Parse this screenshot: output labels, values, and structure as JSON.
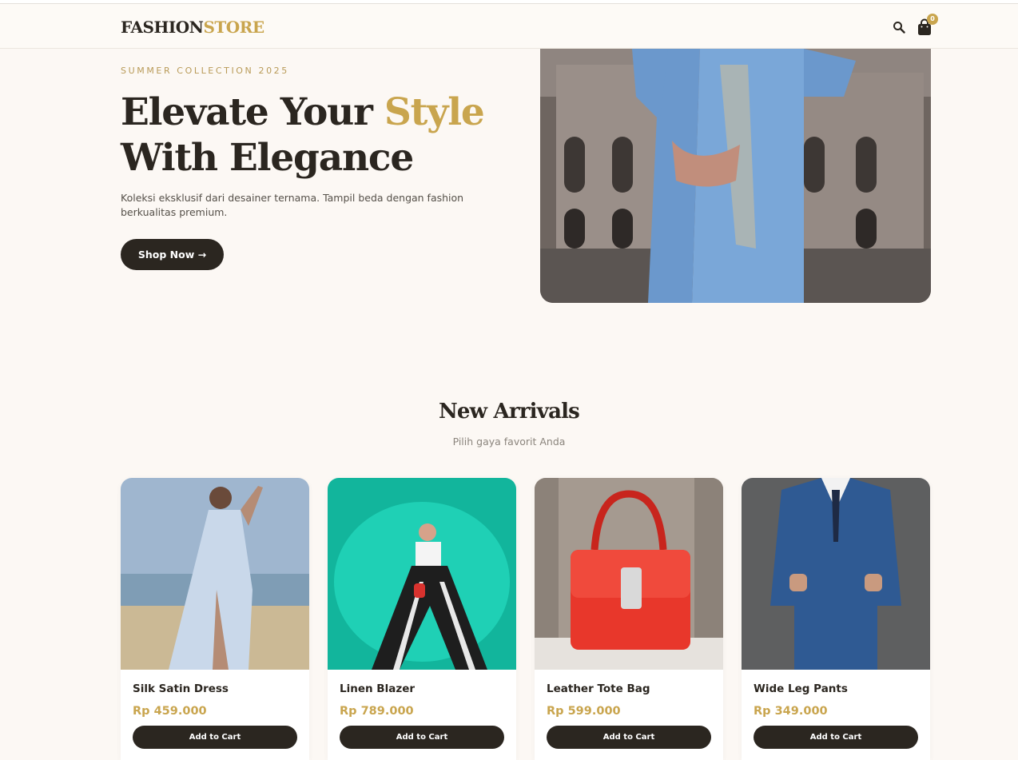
{
  "brand": {
    "name_dark": "FASHION",
    "name_accent": "STORE"
  },
  "header": {
    "cart_count": "0"
  },
  "hero": {
    "eyebrow": "SUMMER COLLECTION 2025",
    "title_line1_dark": "Elevate Your ",
    "title_line1_accent": "Style",
    "title_line2": "With Elegance",
    "description": "Koleksi eksklusif dari desainer ternama. Tampil beda dengan fashion berkualitas premium.",
    "cta_label": "Shop Now →"
  },
  "arrivals": {
    "title": "New Arrivals",
    "subtitle": "Pilih gaya favorit Anda",
    "products": [
      {
        "name": "Silk Satin Dress",
        "price": "Rp 459.000",
        "button": "Add to Cart"
      },
      {
        "name": "Linen Blazer",
        "price": "Rp 789.000",
        "button": "Add to Cart"
      },
      {
        "name": "Leather Tote Bag",
        "price": "Rp 599.000",
        "button": "Add to Cart"
      },
      {
        "name": "Wide Leg Pants",
        "price": "Rp 349.000",
        "button": "Add to Cart"
      }
    ]
  },
  "colors": {
    "accent": "#c9a54e",
    "dark": "#2b2620",
    "background": "#fcf8f4"
  },
  "icons": [
    "search-icon",
    "cart-icon"
  ]
}
